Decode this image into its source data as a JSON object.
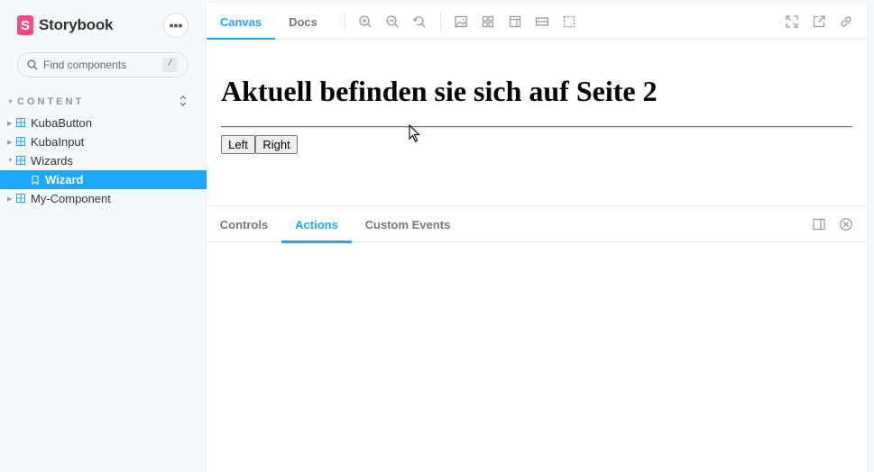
{
  "brand": {
    "name": "Storybook",
    "logo_letter": "S"
  },
  "search": {
    "placeholder": "Find components",
    "shortcut": "/"
  },
  "sidebar": {
    "section_title": "CONTENT",
    "items": [
      {
        "label": "KubaButton",
        "state": "collapsed"
      },
      {
        "label": "KubaInput",
        "state": "collapsed"
      },
      {
        "label": "Wizards",
        "state": "expanded"
      },
      {
        "label": "Wizard",
        "state": "selected"
      },
      {
        "label": "My-Component",
        "state": "collapsed"
      }
    ]
  },
  "toolbar": {
    "tabs": [
      {
        "label": "Canvas",
        "active": true
      },
      {
        "label": "Docs",
        "active": false
      }
    ],
    "tools": [
      "zoom-in-icon",
      "zoom-out-icon",
      "zoom-reset-icon",
      "background-icon",
      "grid-icon",
      "viewport-icon",
      "measure-icon",
      "outline-icon"
    ],
    "right_tools": [
      "fullscreen-icon",
      "open-new-tab-icon",
      "copy-link-icon"
    ]
  },
  "story": {
    "heading": "Aktuell befinden sie sich auf Seite 2",
    "left_button": "Left",
    "right_button": "Right"
  },
  "addons": {
    "tabs": [
      {
        "label": "Controls",
        "active": false
      },
      {
        "label": "Actions",
        "active": true
      },
      {
        "label": "Custom Events",
        "active": false
      }
    ]
  },
  "colors": {
    "accent": "#1ea7fd",
    "brand": "#ff4785",
    "sidebar_bg": "#f6f9fc"
  }
}
